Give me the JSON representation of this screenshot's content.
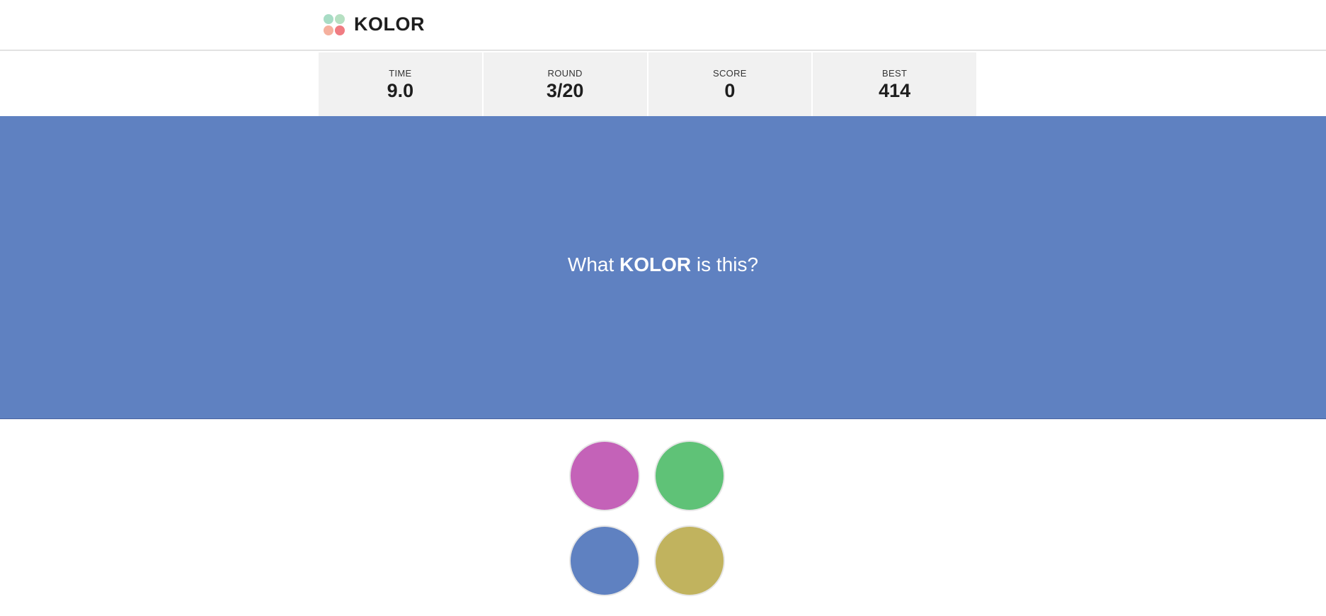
{
  "header": {
    "logo_text": "KOLOR",
    "logo_dot_colors": [
      "#a8dcc5",
      "#b6e0c2",
      "#f5b09e",
      "#f07c82"
    ]
  },
  "stats": [
    {
      "label": "TIME",
      "value": "9.0"
    },
    {
      "label": "ROUND",
      "value": "3/20"
    },
    {
      "label": "SCORE",
      "value": "0"
    },
    {
      "label": "BEST",
      "value": "414"
    }
  ],
  "panel": {
    "color": "#5f81c1",
    "question_prefix": "What ",
    "question_bold": "KOLOR",
    "question_suffix": " is this?"
  },
  "choices": [
    {
      "name": "magenta",
      "color": "#c462b8"
    },
    {
      "name": "green",
      "color": "#5fc277"
    },
    {
      "name": "blue",
      "color": "#5f81c1"
    },
    {
      "name": "olive",
      "color": "#c1b35e"
    }
  ]
}
